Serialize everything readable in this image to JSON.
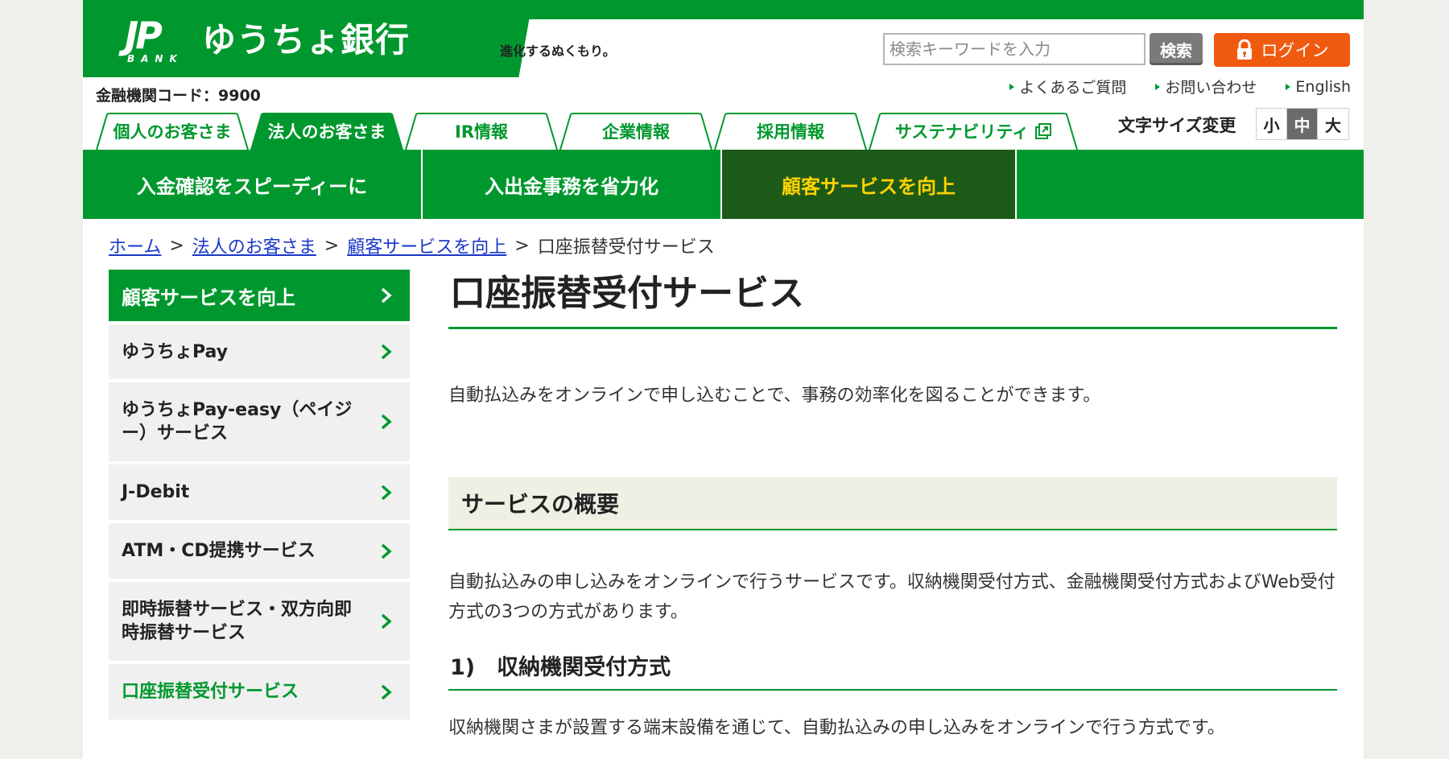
{
  "header": {
    "logo_mark": "JP",
    "logo_sub": "BANK",
    "bank_name": "ゆうちょ銀行",
    "tagline": "進化するぬくもり。",
    "bank_code": "金融機関コード：9900",
    "search_placeholder": "検索キーワードを入力",
    "search_button": "検索",
    "login_button": "ログイン",
    "util_links": [
      "よくあるご質問",
      "お問い合わせ",
      "English"
    ],
    "font_size_label": "文字サイズ変更",
    "font_size_options": [
      "小",
      "中",
      "大"
    ],
    "font_size_selected": "中"
  },
  "tabs": [
    {
      "label": "個人のお客さま",
      "active": false
    },
    {
      "label": "法人のお客さま",
      "active": true
    },
    {
      "label": "IR情報",
      "active": false
    },
    {
      "label": "企業情報",
      "active": false
    },
    {
      "label": "採用情報",
      "active": false
    },
    {
      "label": "サステナビリティ",
      "active": false,
      "external": true
    }
  ],
  "subnav": [
    {
      "label": "入金確認をスピーディーに",
      "active": false
    },
    {
      "label": "入出金事務を省力化",
      "active": false
    },
    {
      "label": "顧客サービスを向上",
      "active": true
    }
  ],
  "breadcrumb": {
    "links": [
      "ホーム",
      "法人のお客さま",
      "顧客サービスを向上"
    ],
    "separator": ">",
    "current": "口座振替受付サービス"
  },
  "sidebar": {
    "heading": "顧客サービスを向上",
    "items": [
      {
        "label": "ゆうちょPay"
      },
      {
        "label": "ゆうちょPay-easy（ペイジー）サービス"
      },
      {
        "label": "J-Debit"
      },
      {
        "label": "ATM・CD提携サービス"
      },
      {
        "label": "即時振替サービス・双方向即時振替サービス"
      },
      {
        "label": "口座振替受付サービス",
        "current": true
      }
    ]
  },
  "main": {
    "title": "口座振替受付サービス",
    "intro": "自動払込みをオンラインで申し込むことで、事務の効率化を図ることができます。",
    "section_title": "サービスの概要",
    "section_text": "自動払込みの申し込みをオンラインで行うサービスです。収納機関受付方式、金融機関受付方式およびWeb受付方式の3つの方式があります。",
    "sub_title": "1)　収納機関受付方式",
    "sub_text": "収納機関さまが設置する端末設備を通じて、自動払込みの申し込みをオンラインで行う方式です。"
  },
  "colors": {
    "brand_green": "#00982e",
    "dark_green": "#1d5a18",
    "highlight_yellow": "#ffd200",
    "login_orange": "#f05a0f",
    "link_blue": "#1a37c8"
  }
}
